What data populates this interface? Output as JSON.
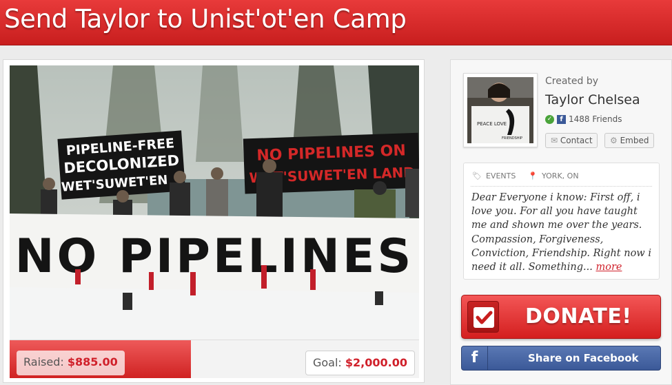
{
  "header": {
    "title": "Send Taylor to Unist'ot'en Camp"
  },
  "photo": {
    "banner_left_line1": "PIPELINE-FREE",
    "banner_left_line2": "DECOLONIZED",
    "banner_left_line3": "WET'SUWET'EN",
    "banner_right_line1": "NO PIPELINES ON",
    "banner_right_line2": "WET'SUWET'EN LAND",
    "banner_main": "NO PIPELINES"
  },
  "progress": {
    "raised_label": "Raised:",
    "raised_amount": "$885.00",
    "goal_label": "Goal:",
    "goal_amount": "$2,000.00",
    "fraction": 0.4425
  },
  "creator": {
    "created_by_label": "Created by",
    "name": "Taylor Chelsea",
    "friends": "1488 Friends",
    "avatar_sign_text": "PEACE LOVE",
    "avatar_sign_text2": "FRIENDSHIP"
  },
  "actions": {
    "contact_label": "Contact",
    "embed_label": "Embed",
    "donate_label": "DONATE!",
    "facebook_label": "Share on Facebook"
  },
  "meta": {
    "category": "EVENTS",
    "location": "YORK, ON"
  },
  "description": {
    "text": "Dear Everyone i know: First off, i love you. For all you have taught me and shown me over the years. Compassion, Forgiveness, Conviction, Friendship. Right now i need it all. Something...",
    "more_label": "more"
  },
  "colors": {
    "brand_red": "#d0202a",
    "facebook_blue": "#3b5998",
    "verified_green": "#4aa33a"
  }
}
